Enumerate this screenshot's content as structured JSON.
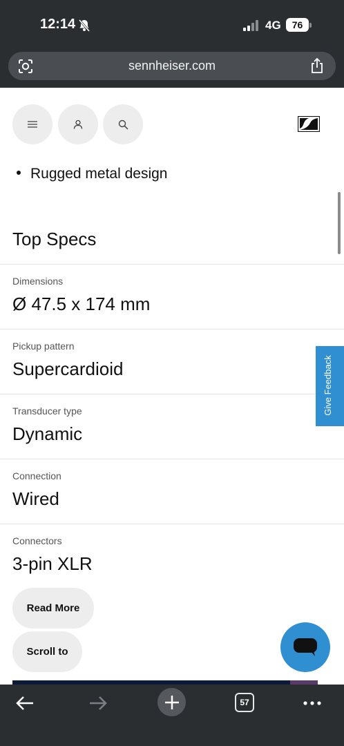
{
  "status_bar": {
    "time": "12:14",
    "network": "4G",
    "battery": "76",
    "icons": [
      "bell-slash-icon",
      "signal-icon",
      "battery-icon"
    ]
  },
  "browser": {
    "url": "sennheiser.com",
    "tab_count": "57",
    "icons": [
      "lens-icon",
      "share-icon",
      "back-arrow-icon",
      "forward-arrow-icon",
      "plus-icon",
      "more-icon"
    ]
  },
  "header": {
    "icons": [
      "menu-icon",
      "user-icon",
      "search-icon",
      "sennheiser-logo-icon"
    ]
  },
  "features": {
    "bullets": [
      "Rugged metal design"
    ]
  },
  "specs": {
    "title": "Top Specs",
    "rows": [
      {
        "label": "Dimensions",
        "value": "Ø 47.5 x 174 mm"
      },
      {
        "label": "Pickup pattern",
        "value": "Supercardioid"
      },
      {
        "label": "Transducer type",
        "value": "Dynamic"
      },
      {
        "label": "Connection",
        "value": "Wired"
      },
      {
        "label": "Connectors",
        "value": "3-pin XLR"
      }
    ]
  },
  "buttons": {
    "read_more": "Read More",
    "scroll_to": "Scroll to"
  },
  "feedback": {
    "label": "Give Feedback"
  },
  "colors": {
    "chrome": "#2b2e31",
    "accent": "#2f8fd1"
  }
}
